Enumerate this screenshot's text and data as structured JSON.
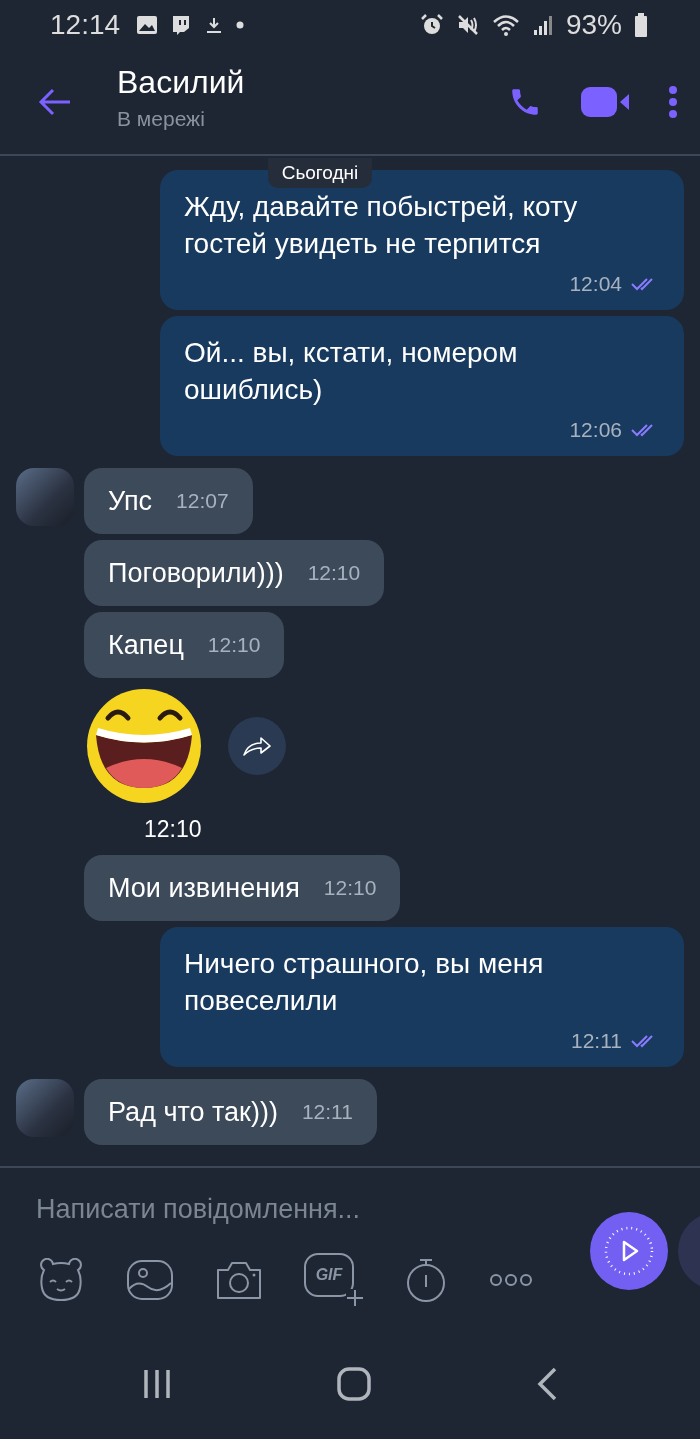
{
  "status_bar": {
    "time": "12:14",
    "battery": "93%"
  },
  "header": {
    "title": "Василий",
    "subtitle": "В мережі"
  },
  "date_chip": "Сьогодні",
  "messages": [
    {
      "kind": "outgoing",
      "text": "Жду, давайте побыстрей, коту гостей увидеть не терпится",
      "time": "12:04",
      "read": true
    },
    {
      "kind": "outgoing",
      "text": "Ой... вы, кстати, номером ошиблись)",
      "time": "12:06",
      "read": true
    },
    {
      "kind": "incoming",
      "text": "Упс",
      "time": "12:07",
      "avatar": true
    },
    {
      "kind": "incoming",
      "text": "Поговорили)))",
      "time": "12:10",
      "avatar": false
    },
    {
      "kind": "incoming",
      "text": "Капец",
      "time": "12:10",
      "avatar": false
    },
    {
      "kind": "sticker",
      "time": "12:10"
    },
    {
      "kind": "incoming",
      "text": "Мои извинения",
      "time": "12:10",
      "avatar": false
    },
    {
      "kind": "outgoing",
      "text": "Ничего страшного, вы меня повеселили",
      "time": "12:11",
      "read": true
    },
    {
      "kind": "incoming",
      "text": "Рад что так)))",
      "time": "12:11",
      "avatar": true
    }
  ],
  "composer": {
    "placeholder": "Написати повідомлення...",
    "gif_label": "GIF"
  }
}
